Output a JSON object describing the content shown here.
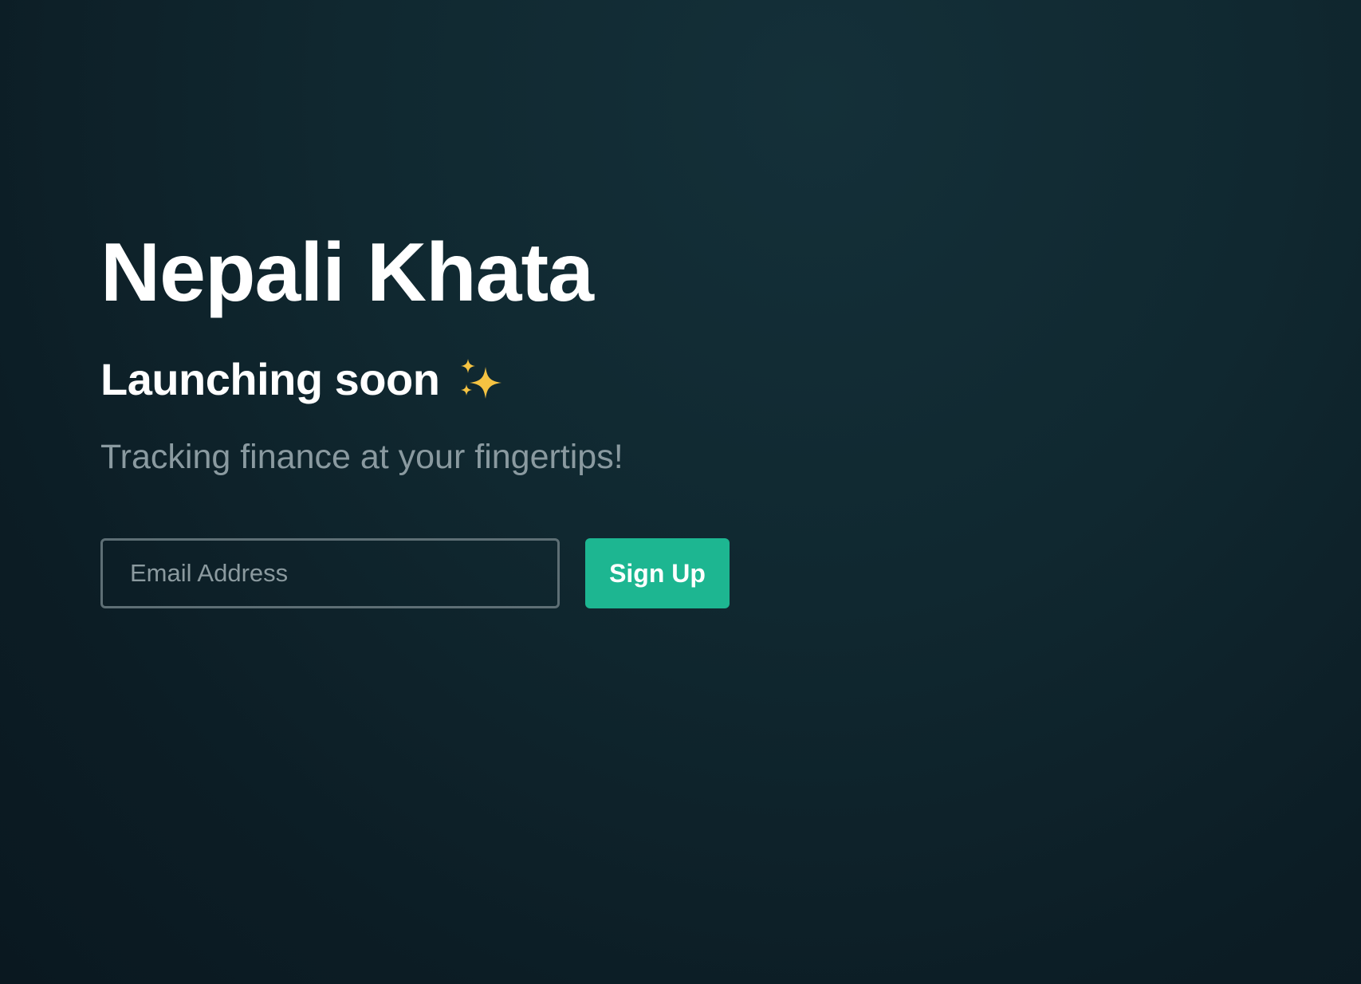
{
  "hero": {
    "title": "Nepali Khata",
    "subtitle": "Launching soon",
    "subtitle_icon": "sparkles-icon",
    "tagline": "Tracking finance at your fingertips!"
  },
  "form": {
    "email_placeholder": "Email Address",
    "email_value": "",
    "signup_label": "Sign Up"
  },
  "colors": {
    "background": "#102830",
    "accent": "#1db691",
    "sparkle": "#f5c342"
  }
}
